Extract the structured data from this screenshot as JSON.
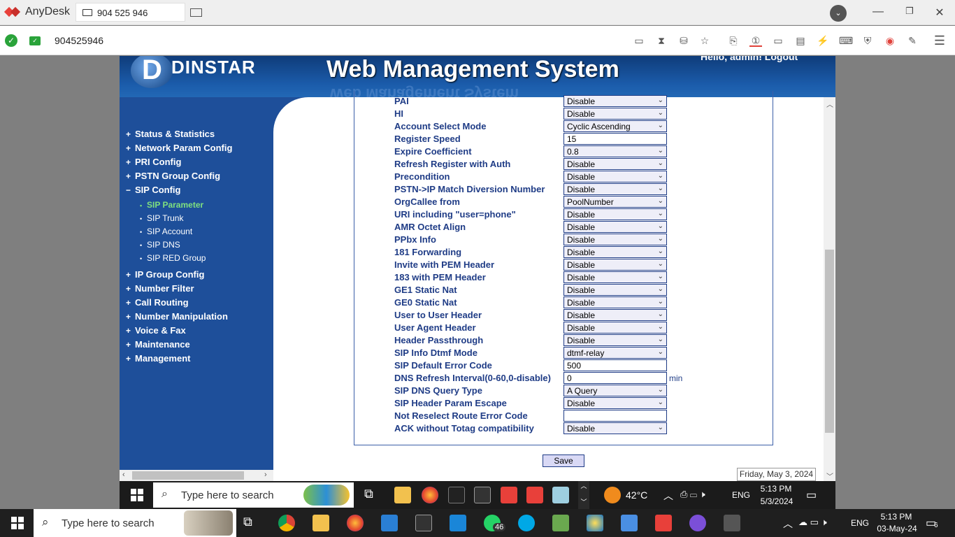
{
  "anydesk": {
    "app_name": "AnyDesk",
    "tab_label": "904 525 946",
    "address": "904525946"
  },
  "banner": {
    "brand": "DINSTAR",
    "title": "Web Management System",
    "greeting": "Hello, admin!   Logout"
  },
  "nav": {
    "items": [
      {
        "label": "Status & Statistics",
        "sign": "+"
      },
      {
        "label": "Network Param Config",
        "sign": "+"
      },
      {
        "label": "PRI Config",
        "sign": "+"
      },
      {
        "label": "PSTN Group Config",
        "sign": "+"
      },
      {
        "label": "SIP Config",
        "sign": "−"
      },
      {
        "label": "IP Group Config",
        "sign": "+"
      },
      {
        "label": "Number Filter",
        "sign": "+"
      },
      {
        "label": "Call Routing",
        "sign": "+"
      },
      {
        "label": "Number Manipulation",
        "sign": "+"
      },
      {
        "label": "Voice & Fax",
        "sign": "+"
      },
      {
        "label": "Maintenance",
        "sign": "+"
      },
      {
        "label": "Management",
        "sign": "+"
      }
    ],
    "sip_sub": [
      {
        "label": "SIP Parameter",
        "active": true
      },
      {
        "label": "SIP Trunk"
      },
      {
        "label": "SIP Account"
      },
      {
        "label": "SIP DNS"
      },
      {
        "label": "SIP RED Group"
      }
    ]
  },
  "form": {
    "rows": [
      {
        "label": "PAI",
        "value": "Disable",
        "kind": "select"
      },
      {
        "label": "HI",
        "value": "Disable",
        "kind": "select"
      },
      {
        "label": "Account Select Mode",
        "value": "Cyclic Ascending",
        "kind": "select"
      },
      {
        "label": "Register Speed",
        "value": "15",
        "kind": "text"
      },
      {
        "label": "Expire Coefficient",
        "value": "0.8",
        "kind": "select"
      },
      {
        "label": "Refresh Register with Auth",
        "value": "Disable",
        "kind": "select"
      },
      {
        "label": "Precondition",
        "value": "Disable",
        "kind": "select"
      },
      {
        "label": "PSTN->IP Match Diversion Number",
        "value": "Disable",
        "kind": "select"
      },
      {
        "label": "OrgCallee from",
        "value": "PoolNumber",
        "kind": "select"
      },
      {
        "label": "URI including \"user=phone\"",
        "value": "Disable",
        "kind": "select"
      },
      {
        "label": "AMR Octet Align",
        "value": "Disable",
        "kind": "select"
      },
      {
        "label": "PPbx Info",
        "value": "Disable",
        "kind": "select"
      },
      {
        "label": "181 Forwarding",
        "value": "Disable",
        "kind": "select"
      },
      {
        "label": "Invite with PEM Header",
        "value": "Disable",
        "kind": "select"
      },
      {
        "label": "183 with PEM Header",
        "value": "Disable",
        "kind": "select"
      },
      {
        "label": "GE1 Static Nat",
        "value": "Disable",
        "kind": "select"
      },
      {
        "label": "GE0 Static Nat",
        "value": "Disable",
        "kind": "select"
      },
      {
        "label": "User to User Header",
        "value": "Disable",
        "kind": "select"
      },
      {
        "label": "User Agent Header",
        "value": "Disable",
        "kind": "select"
      },
      {
        "label": "Header Passthrough",
        "value": "Disable",
        "kind": "select"
      },
      {
        "label": "SIP Info Dtmf Mode",
        "value": "dtmf-relay",
        "kind": "select"
      },
      {
        "label": "SIP Default Error Code",
        "value": "500",
        "kind": "text"
      },
      {
        "label": "DNS Refresh Interval(0-60,0-disable)",
        "value": "0",
        "kind": "text",
        "unit": "min"
      },
      {
        "label": "SIP DNS Query Type",
        "value": "A Query",
        "kind": "select"
      },
      {
        "label": "SIP Header Param Escape",
        "value": "Disable",
        "kind": "select"
      },
      {
        "label": "Not Reselect Route Error Code",
        "value": "",
        "kind": "text"
      },
      {
        "label": "ACK without Totag compatibility",
        "value": "Disable",
        "kind": "select"
      }
    ],
    "save_label": "Save"
  },
  "status_date": "Friday, May 3, 2024",
  "remote_taskbar": {
    "search_placeholder": "Type here to search",
    "weather": "42°C",
    "lang": "ENG",
    "time": "5:13 PM",
    "date": "5/3/2024"
  },
  "host_taskbar": {
    "search_placeholder": "Type here to search",
    "whatsapp_badge": "46",
    "lang": "ENG",
    "time": "5:13 PM",
    "date": "03-May-24",
    "notif_count": "6"
  }
}
